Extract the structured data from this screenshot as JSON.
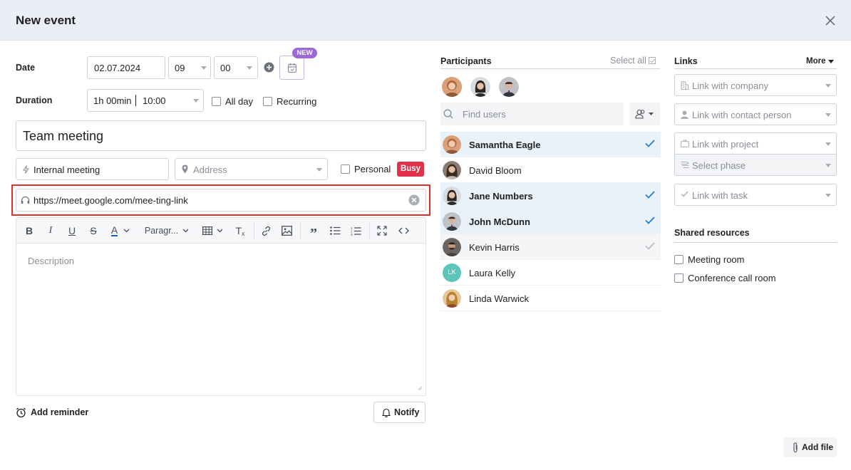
{
  "header": {
    "title": "New event"
  },
  "form": {
    "date_label": "Date",
    "date_value": "02.07.2024",
    "hour_value": "09",
    "minute_value": "00",
    "new_badge": "NEW",
    "duration_label": "Duration",
    "duration_value": "1h 00min",
    "end_time": "10:00",
    "allday_label": "All day",
    "recurring_label": "Recurring",
    "event_title": "Team meeting",
    "event_type": "Internal meeting",
    "address_placeholder": "Address",
    "personal_label": "Personal",
    "busy_label": "Busy",
    "meeting_link": "https://meet.google.com/mee-ting-link",
    "paragraph_select": "Paragr...",
    "description_placeholder": "Description",
    "add_reminder_label": "Add reminder",
    "notify_label": "Notify",
    "add_file_label": "Add file"
  },
  "participants": {
    "heading": "Participants",
    "select_all": "Select all",
    "find_placeholder": "Find users",
    "list": [
      {
        "name": "Samantha Eagle",
        "selected": true,
        "check": "blue"
      },
      {
        "name": "David Bloom",
        "selected": false,
        "check": "none"
      },
      {
        "name": "Jane Numbers",
        "selected": true,
        "check": "blue"
      },
      {
        "name": "John McDunn",
        "selected": true,
        "check": "blue"
      },
      {
        "name": "Kevin Harris",
        "selected": false,
        "check": "grey"
      },
      {
        "name": "Laura Kelly",
        "selected": false,
        "check": "none",
        "initials": "LK"
      },
      {
        "name": "Linda Warwick",
        "selected": false,
        "check": "none"
      }
    ]
  },
  "links": {
    "heading": "Links",
    "more": "More",
    "company": "Link with company",
    "contact": "Link with contact person",
    "project": "Link with project",
    "phase": "Select phase",
    "task": "Link with task"
  },
  "shared": {
    "heading": "Shared resources",
    "items": [
      "Meeting room",
      "Conference call room"
    ]
  },
  "colors": {
    "accent": "#1a7fd4",
    "busy": "#e0304a",
    "new_badge": "#9b6ad6",
    "highlight": "#e0302f",
    "selected_row": "#e8f2f8"
  }
}
